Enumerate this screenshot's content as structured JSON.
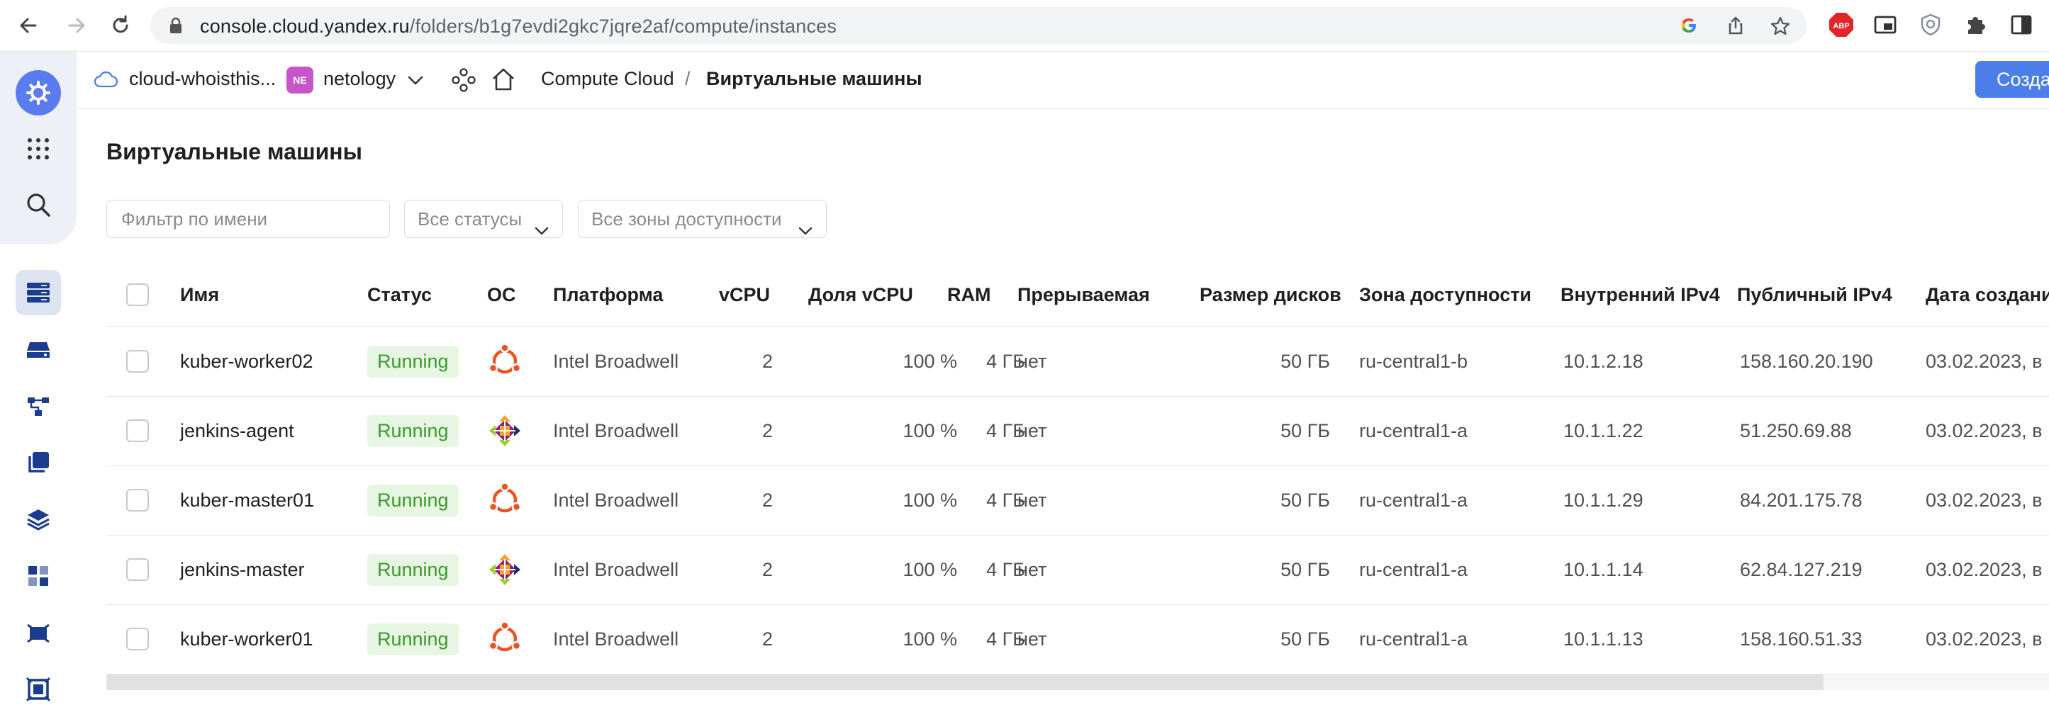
{
  "browser": {
    "url_host": "console.cloud.yandex.ru",
    "url_path": "/folders/b1g7evdi2gkc7jqre2af/compute/instances",
    "extensions": [
      "google-icon",
      "share-icon",
      "star-icon",
      "abp-icon",
      "pip-icon",
      "shield-icon",
      "puzzle-icon",
      "sidepanel-icon"
    ]
  },
  "header": {
    "cloud": "cloud-whoisthis...",
    "folder_badge": "NE",
    "folder": "netology",
    "service": "Compute Cloud",
    "separator": "/",
    "current": "Виртуальные машины",
    "create_button": "Создать"
  },
  "page": {
    "title": "Виртуальные машины",
    "filter_placeholder": "Фильтр по имени",
    "status_select": "Все статусы",
    "zone_select": "Все зоны доступности"
  },
  "table": {
    "columns": {
      "name": "Имя",
      "status": "Статус",
      "os": "ОС",
      "platform": "Платформа",
      "vcpu": "vCPU",
      "vcpu_share": "Доля vCPU",
      "ram": "RAM",
      "preemptible": "Прерываемая",
      "disk_size": "Размер дисков",
      "zone": "Зона доступности",
      "internal_ip": "Внутренний IPv4",
      "public_ip": "Публичный IPv4",
      "created": "Дата создания"
    },
    "rows": [
      {
        "name": "kuber-worker02",
        "status": "Running",
        "os": "ubuntu",
        "platform": "Intel Broadwell",
        "vcpu": "2",
        "vcpu_share": "100 %",
        "ram": "4 ГБ",
        "preemptible": "нет",
        "disk_size": "50 ГБ",
        "zone": "ru-central1-b",
        "internal_ip": "10.1.2.18",
        "public_ip": "158.160.20.190",
        "created": "03.02.2023, в"
      },
      {
        "name": "jenkins-agent",
        "status": "Running",
        "os": "centos",
        "platform": "Intel Broadwell",
        "vcpu": "2",
        "vcpu_share": "100 %",
        "ram": "4 ГБ",
        "preemptible": "нет",
        "disk_size": "50 ГБ",
        "zone": "ru-central1-a",
        "internal_ip": "10.1.1.22",
        "public_ip": "51.250.69.88",
        "created": "03.02.2023, в"
      },
      {
        "name": "kuber-master01",
        "status": "Running",
        "os": "ubuntu",
        "platform": "Intel Broadwell",
        "vcpu": "2",
        "vcpu_share": "100 %",
        "ram": "4 ГБ",
        "preemptible": "нет",
        "disk_size": "50 ГБ",
        "zone": "ru-central1-a",
        "internal_ip": "10.1.1.29",
        "public_ip": "84.201.175.78",
        "created": "03.02.2023, в"
      },
      {
        "name": "jenkins-master",
        "status": "Running",
        "os": "centos",
        "platform": "Intel Broadwell",
        "vcpu": "2",
        "vcpu_share": "100 %",
        "ram": "4 ГБ",
        "preemptible": "нет",
        "disk_size": "50 ГБ",
        "zone": "ru-central1-a",
        "internal_ip": "10.1.1.14",
        "public_ip": "62.84.127.219",
        "created": "03.02.2023, в"
      },
      {
        "name": "kuber-worker01",
        "status": "Running",
        "os": "ubuntu",
        "platform": "Intel Broadwell",
        "vcpu": "2",
        "vcpu_share": "100 %",
        "ram": "4 ГБ",
        "preemptible": "нет",
        "disk_size": "50 ГБ",
        "zone": "ru-central1-a",
        "internal_ip": "10.1.1.13",
        "public_ip": "158.160.51.33",
        "created": "03.02.2023, в"
      }
    ]
  },
  "colors": {
    "accent": "#4b7ee8",
    "running_bg": "#e6f6e2",
    "running_text": "#3b9a2c",
    "ubuntu": "#e95420"
  }
}
